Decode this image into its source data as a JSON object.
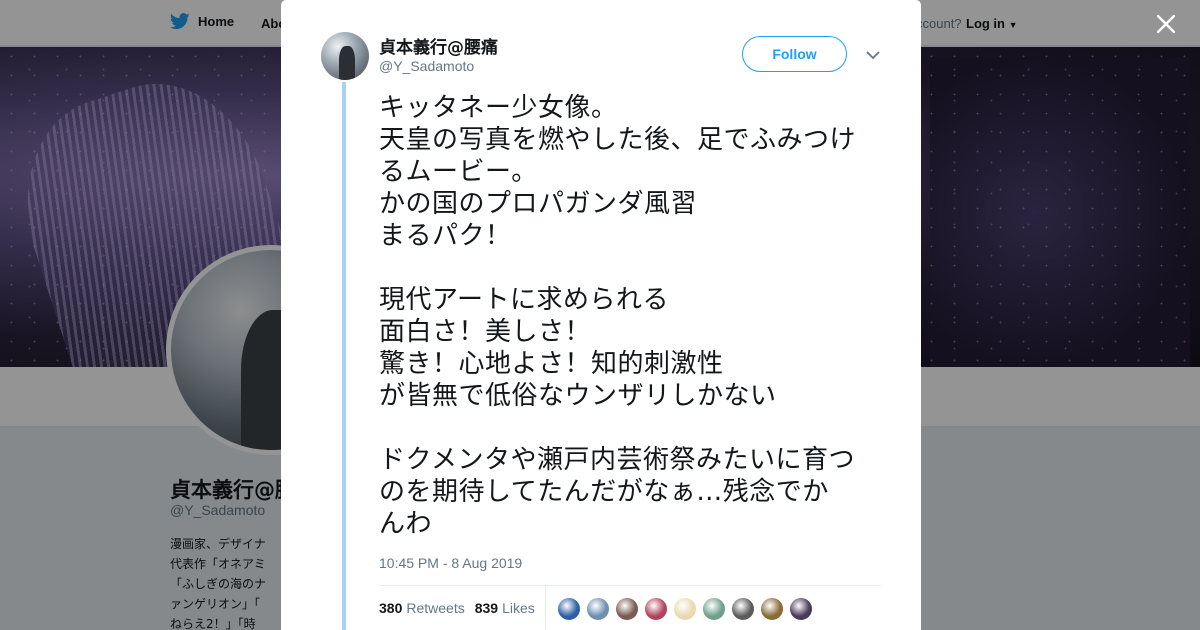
{
  "topbar": {
    "home_label": "Home",
    "about_label": "Abo",
    "account_prompt": "ccount?",
    "login_label": "Log in"
  },
  "profile": {
    "name": "貞本義行@腰痛",
    "handle": "@Y_Sadamoto",
    "bio": "漫画家、デザイナ\n代表作「オネアミ\n「ふしぎの海のナ\nァンゲリオン」「\nねらえ2！」「時"
  },
  "tweet": {
    "author_name": "貞本義行@腰痛",
    "author_handle": "@Y_Sadamoto",
    "follow_label": "Follow",
    "text_lines": [
      "キッタネー少女像。",
      "天皇の写真を燃やした後、足でふみつけ",
      "るムービー。",
      "かの国のプロパガンダ風習",
      "まるパク！",
      "",
      "現代アートに求められる",
      "面白さ！美しさ！",
      "驚き！心地よさ！知的刺激性",
      "が皆無で低俗なウンザリしかない",
      "",
      "ドクメンタや瀬戸内芸術祭みたいに育つ",
      "のを期待してたんだがなぁ…残念でか",
      "んわ"
    ],
    "timestamp": "10:45 PM - 8 Aug 2019",
    "retweets_count": "380",
    "retweets_label": "Retweets",
    "likes_count": "839",
    "likes_label": "Likes"
  },
  "likers": [
    {
      "name": "liker-avatar-1",
      "color": "#2d5fa8"
    },
    {
      "name": "liker-avatar-2",
      "color": "#6f8fb0"
    },
    {
      "name": "liker-avatar-3",
      "color": "#7a5a52"
    },
    {
      "name": "liker-avatar-4",
      "color": "#b0445e"
    },
    {
      "name": "liker-avatar-5",
      "color": "#e8d9b0"
    },
    {
      "name": "liker-avatar-6",
      "color": "#6fa08a"
    },
    {
      "name": "liker-avatar-7",
      "color": "#5c5c5c"
    },
    {
      "name": "liker-avatar-8",
      "color": "#8a6a3a"
    },
    {
      "name": "liker-avatar-9",
      "color": "#4a3a5a"
    }
  ],
  "colors": {
    "accent": "#1da1f2",
    "thread_line": "#a6d4f2"
  },
  "icons": {
    "brand": "twitter-bird-icon",
    "close": "close-icon",
    "more": "chevron-down-icon"
  }
}
